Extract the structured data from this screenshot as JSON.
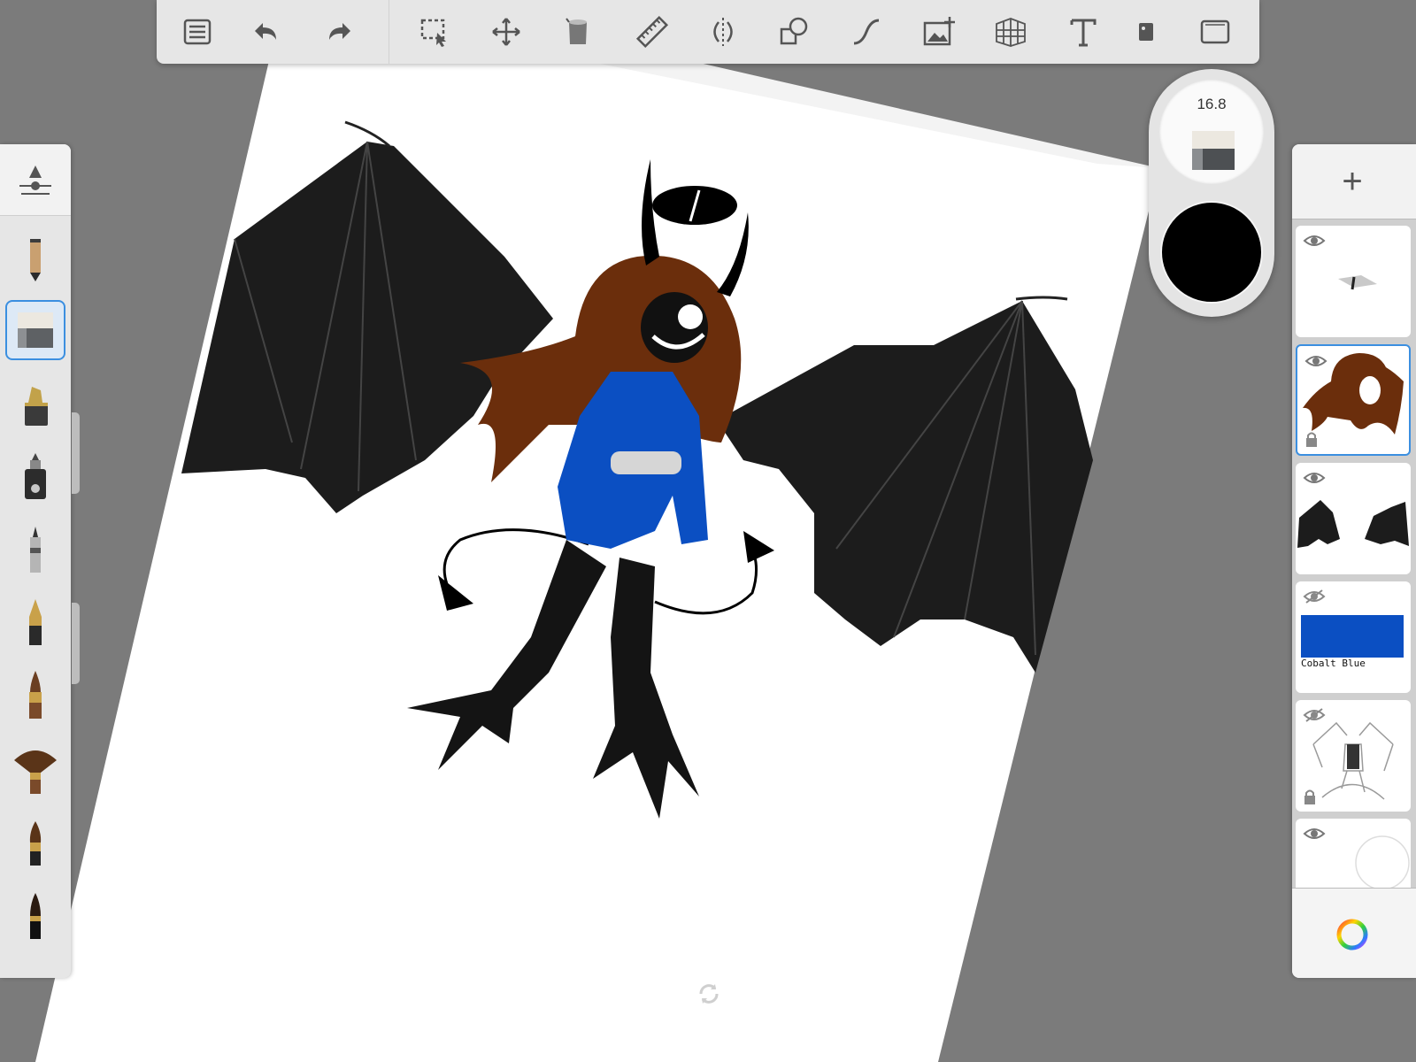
{
  "app": {
    "name": "sketchbook-style drawing app"
  },
  "toolbar": {
    "items": [
      {
        "icon": "list-icon"
      },
      {
        "icon": "undo-icon"
      },
      {
        "icon": "redo-icon"
      },
      {
        "icon": "selection-icon"
      },
      {
        "icon": "transform-move-icon"
      },
      {
        "icon": "fill-bucket-icon"
      },
      {
        "icon": "ruler-icon"
      },
      {
        "icon": "symmetry-icon"
      },
      {
        "icon": "shapes-icon"
      },
      {
        "icon": "stroke-curve-icon"
      },
      {
        "icon": "add-image-icon"
      },
      {
        "icon": "perspective-grid-icon"
      },
      {
        "icon": "text-icon"
      },
      {
        "icon": "flipbook-icon"
      },
      {
        "icon": "fullscreen-icon"
      }
    ]
  },
  "brushes": {
    "items": [
      {
        "icon": "pencil-brush-icon"
      },
      {
        "icon": "eraser-brush-icon",
        "selected": true
      },
      {
        "icon": "marker-brush-icon"
      },
      {
        "icon": "airbrush-brush-icon"
      },
      {
        "icon": "ballpoint-brush-icon"
      },
      {
        "icon": "fountain-pen-brush-icon"
      },
      {
        "icon": "paint-brush-icon"
      },
      {
        "icon": "fan-brush-icon"
      },
      {
        "icon": "round-brush-icon"
      },
      {
        "icon": "ink-brush-icon"
      }
    ]
  },
  "puck": {
    "size_value": "16.8",
    "color": "#000000"
  },
  "layers": {
    "items": [
      {
        "icon": "eraser-thumbnail",
        "visible": true
      },
      {
        "icon": "hair-thumbnail",
        "visible": true,
        "active": true,
        "locked": true
      },
      {
        "icon": "wings-thumbnail",
        "visible": true
      },
      {
        "icon": "swatch-thumbnail",
        "visible": false,
        "label": "Cobalt Blue",
        "swatch_color": "#0b4fc2"
      },
      {
        "icon": "sketch-thumbnail",
        "visible": false,
        "locked": true
      },
      {
        "icon": "background-thumbnail",
        "visible": true
      }
    ]
  },
  "colors": {
    "panel_bg": "#e6e6e6",
    "accent": "#3b8fe0",
    "canvas_bg": "#7b7b7b",
    "cobalt_blue": "#0b4fc2",
    "hair_brown": "#6b2e0c"
  }
}
